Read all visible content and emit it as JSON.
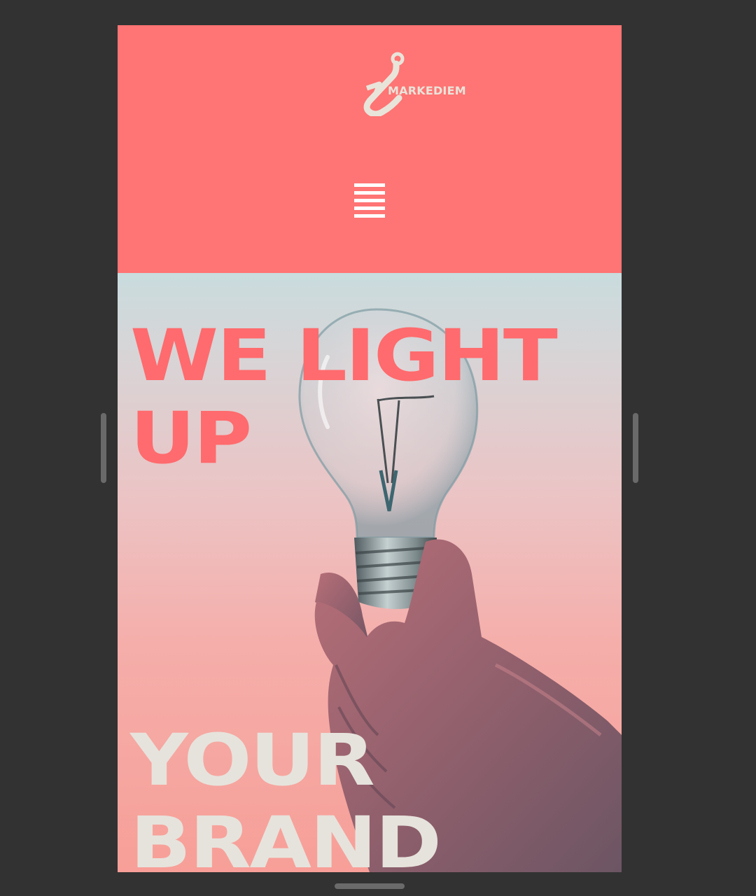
{
  "brand": {
    "name": "MARKEDIEM",
    "logo_icon": "fish-hook-icon"
  },
  "nav": {
    "menu_icon": "hamburger-menu-icon"
  },
  "hero": {
    "headline_top": "WE LIGHT\nUP",
    "headline_bottom": "YOUR\nBRAND",
    "image": "hand holding light bulb photo"
  },
  "colors": {
    "brand_coral": "#ff7474",
    "headline_coral": "#ff6b6e",
    "headline_cream": "#e6e3dc",
    "logo_cream": "#e8e4da",
    "frame_dark": "#323232"
  }
}
